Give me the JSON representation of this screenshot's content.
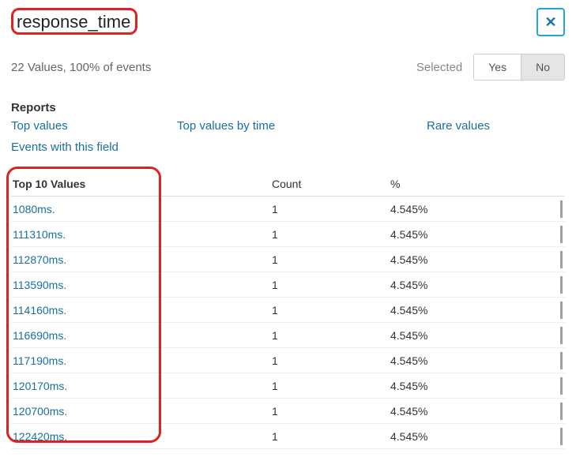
{
  "title": "response_time",
  "summary": "22 Values, 100% of events",
  "selected": {
    "label": "Selected",
    "yes": "Yes",
    "no": "No",
    "active": "no"
  },
  "reports": {
    "heading": "Reports",
    "links": {
      "top_values": "Top values",
      "top_values_by_time": "Top values by time",
      "rare_values": "Rare values",
      "events_with_field": "Events with this field"
    }
  },
  "table": {
    "headers": {
      "values": "Top 10 Values",
      "count": "Count",
      "percent": "%"
    },
    "rows": [
      {
        "value": "1080ms.",
        "count": "1",
        "percent": "4.545%"
      },
      {
        "value": "111310ms.",
        "count": "1",
        "percent": "4.545%"
      },
      {
        "value": "112870ms.",
        "count": "1",
        "percent": "4.545%"
      },
      {
        "value": "113590ms.",
        "count": "1",
        "percent": "4.545%"
      },
      {
        "value": "114160ms.",
        "count": "1",
        "percent": "4.545%"
      },
      {
        "value": "116690ms.",
        "count": "1",
        "percent": "4.545%"
      },
      {
        "value": "117190ms.",
        "count": "1",
        "percent": "4.545%"
      },
      {
        "value": "120170ms.",
        "count": "1",
        "percent": "4.545%"
      },
      {
        "value": "120700ms.",
        "count": "1",
        "percent": "4.545%"
      },
      {
        "value": "122420ms.",
        "count": "1",
        "percent": "4.545%"
      }
    ]
  }
}
